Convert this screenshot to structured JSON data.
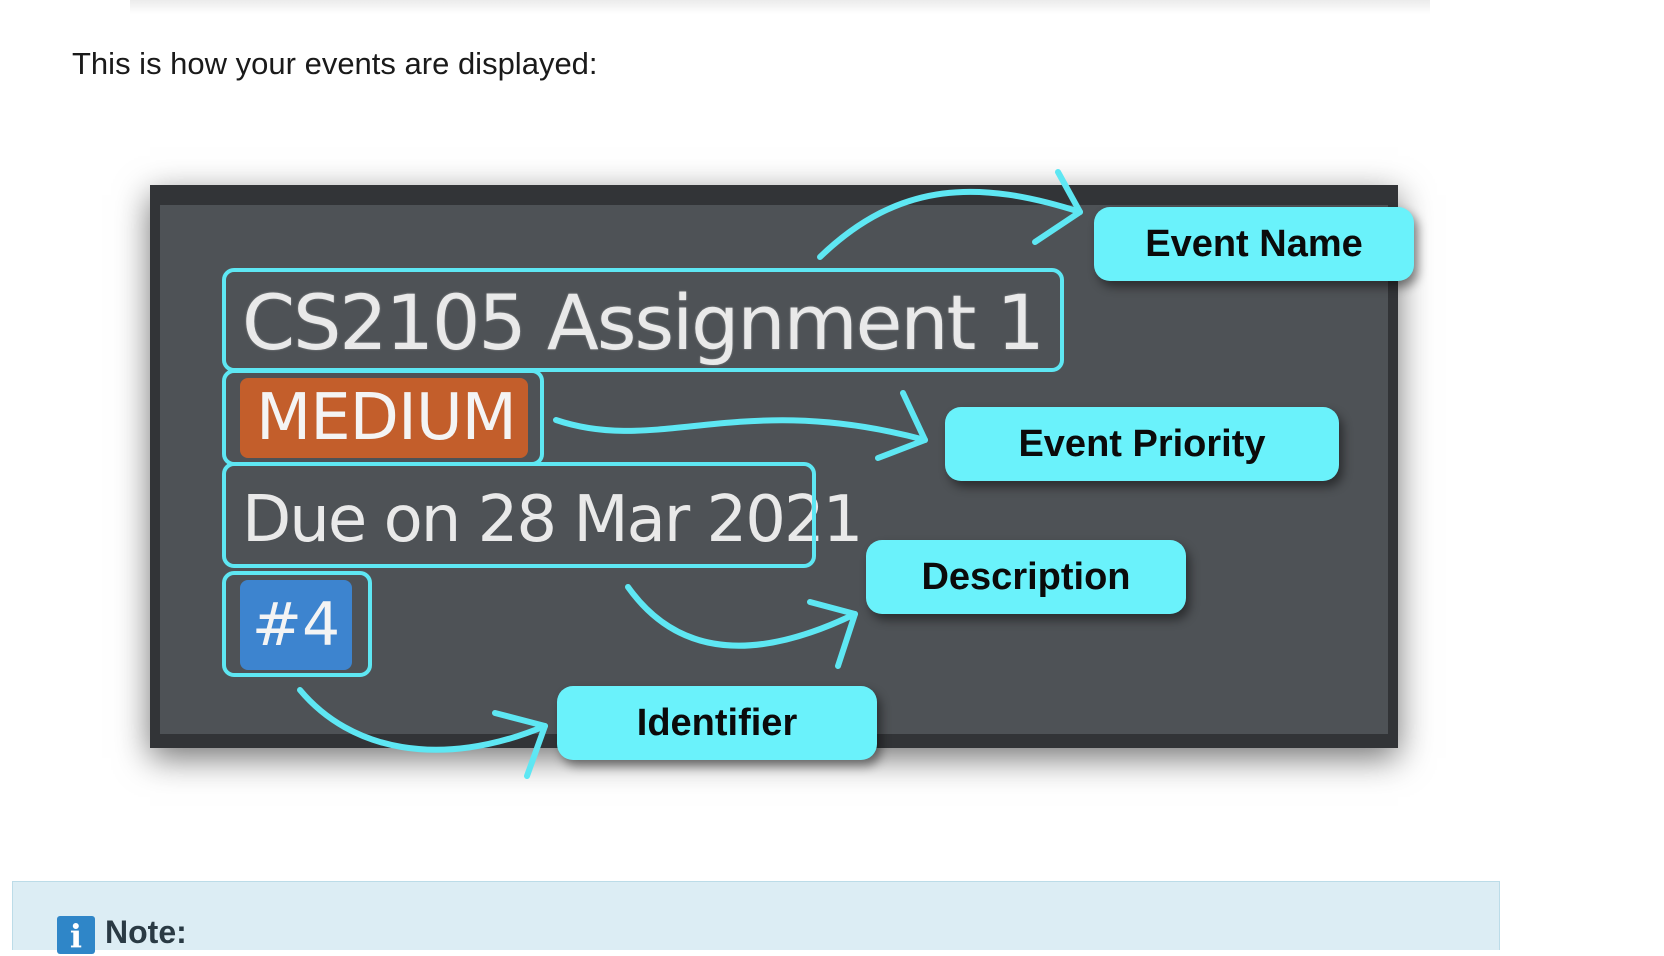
{
  "intro_text": "This is how your events are displayed:",
  "event_card": {
    "name": "CS2105 Assignment 1",
    "priority": "MEDIUM",
    "description": "Due on 28 Mar 2021",
    "identifier": "#4"
  },
  "callouts": {
    "event_name": "Event Name",
    "event_priority": "Event Priority",
    "description": "Description",
    "identifier": "Identifier"
  },
  "note": {
    "icon": "info-icon",
    "icon_glyph": "i",
    "title": "Note:"
  },
  "colors": {
    "highlight": "#5ee7f3",
    "callout_bg": "#6af2fb",
    "card_bg": "#4e5256",
    "priority_medium": "#c35e2b",
    "identifier_bg": "#3d84cf",
    "note_bg": "#dcedf4"
  }
}
